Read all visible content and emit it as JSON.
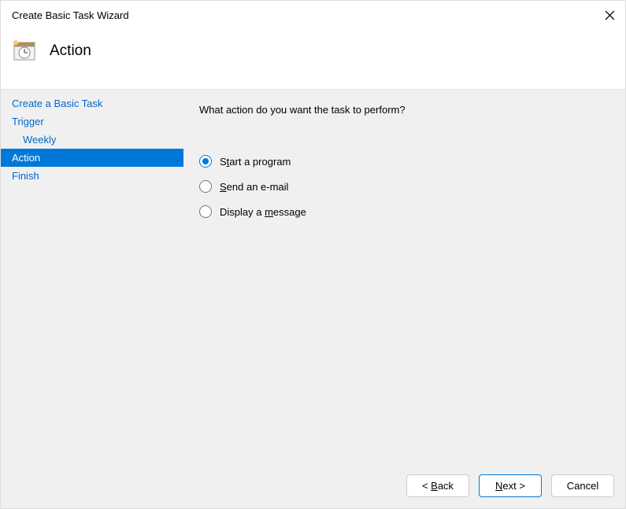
{
  "titlebar": {
    "title": "Create Basic Task Wizard"
  },
  "header": {
    "heading": "Action"
  },
  "sidebar": {
    "items": [
      {
        "label": "Create a Basic Task"
      },
      {
        "label": "Trigger"
      },
      {
        "label": "Weekly"
      },
      {
        "label": "Action"
      },
      {
        "label": "Finish"
      }
    ]
  },
  "content": {
    "prompt": "What action do you want the task to perform?",
    "options": [
      {
        "prefix": "S",
        "u": "t",
        "suffix": "art a program"
      },
      {
        "u": "S",
        "suffix": "end an e-mail"
      },
      {
        "prefix": "Display a ",
        "u": "m",
        "suffix": "essage"
      }
    ]
  },
  "buttons": {
    "back": {
      "lt": "< ",
      "u": "B",
      "rest": "ack"
    },
    "next": {
      "u": "N",
      "rest": "ext >"
    },
    "cancel": "Cancel"
  }
}
